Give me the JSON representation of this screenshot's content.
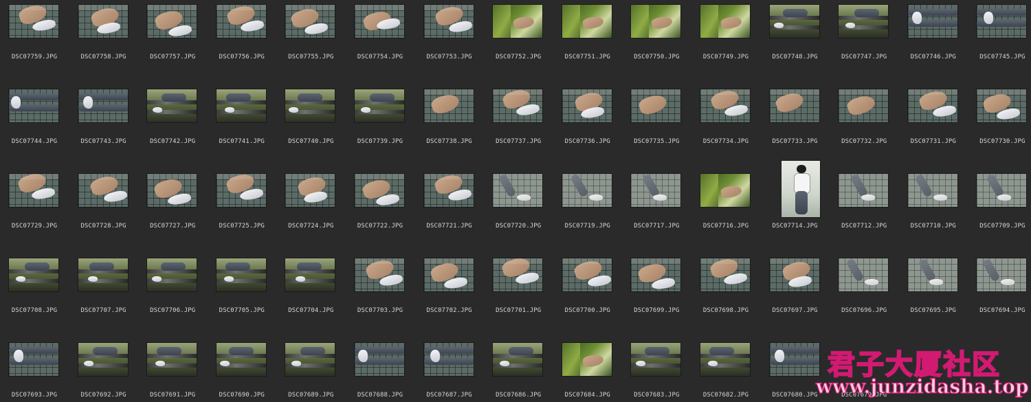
{
  "files": [
    {
      "name": "DSC07759.JPG",
      "v": "fs"
    },
    {
      "name": "DSC07758.JPG",
      "v": "fs"
    },
    {
      "name": "DSC07757.JPG",
      "v": "fs"
    },
    {
      "name": "DSC07756.JPG",
      "v": "fs"
    },
    {
      "name": "DSC07755.JPG",
      "v": "fs"
    },
    {
      "name": "DSC07754.JPG",
      "v": "fs"
    },
    {
      "name": "DSC07753.JPG",
      "v": "fs"
    },
    {
      "name": "DSC07752.JPG",
      "v": "gr"
    },
    {
      "name": "DSC07751.JPG",
      "v": "gr"
    },
    {
      "name": "DSC07750.JPG",
      "v": "gr"
    },
    {
      "name": "DSC07749.JPG",
      "v": "gr"
    },
    {
      "name": "DSC07748.JPG",
      "v": "bn"
    },
    {
      "name": "DSC07747.JPG",
      "v": "bn"
    },
    {
      "name": "DSC07746.JPG",
      "v": "lg"
    },
    {
      "name": "DSC07745.JPG",
      "v": "lg"
    },
    {
      "name": "DSC07744.JPG",
      "v": "lg"
    },
    {
      "name": "DSC07743.JPG",
      "v": "lg"
    },
    {
      "name": "DSC07742.JPG",
      "v": "bn"
    },
    {
      "name": "DSC07741.JPG",
      "v": "bn"
    },
    {
      "name": "DSC07740.JPG",
      "v": "bn"
    },
    {
      "name": "DSC07739.JPG",
      "v": "bn"
    },
    {
      "name": "DSC07738.JPG",
      "v": "ft"
    },
    {
      "name": "DSC07737.JPG",
      "v": "fs"
    },
    {
      "name": "DSC07736.JPG",
      "v": "fs"
    },
    {
      "name": "DSC07735.JPG",
      "v": "ft"
    },
    {
      "name": "DSC07734.JPG",
      "v": "fs"
    },
    {
      "name": "DSC07733.JPG",
      "v": "ft"
    },
    {
      "name": "DSC07732.JPG",
      "v": "ft"
    },
    {
      "name": "DSC07731.JPG",
      "v": "fs"
    },
    {
      "name": "DSC07730.JPG",
      "v": "fs"
    },
    {
      "name": "DSC07729.JPG",
      "v": "fs"
    },
    {
      "name": "DSC07728.JPG",
      "v": "fs"
    },
    {
      "name": "DSC07727.JPG",
      "v": "fs"
    },
    {
      "name": "DSC07725.JPG",
      "v": "fs"
    },
    {
      "name": "DSC07724.JPG",
      "v": "fs"
    },
    {
      "name": "DSC07722.JPG",
      "v": "fs"
    },
    {
      "name": "DSC07721.JPG",
      "v": "fs"
    },
    {
      "name": "DSC07720.JPG",
      "v": "pv"
    },
    {
      "name": "DSC07719.JPG",
      "v": "pv"
    },
    {
      "name": "DSC07717.JPG",
      "v": "pv"
    },
    {
      "name": "DSC07716.JPG",
      "v": "gr"
    },
    {
      "name": "DSC07714.JPG",
      "v": "pt"
    },
    {
      "name": "DSC07712.JPG",
      "v": "pv"
    },
    {
      "name": "DSC07710.JPG",
      "v": "pv"
    },
    {
      "name": "DSC07709.JPG",
      "v": "pv"
    },
    {
      "name": "DSC07708.JPG",
      "v": "bn"
    },
    {
      "name": "DSC07707.JPG",
      "v": "bn"
    },
    {
      "name": "DSC07706.JPG",
      "v": "bn"
    },
    {
      "name": "DSC07705.JPG",
      "v": "bn"
    },
    {
      "name": "DSC07704.JPG",
      "v": "bn"
    },
    {
      "name": "DSC07703.JPG",
      "v": "fs"
    },
    {
      "name": "DSC07702.JPG",
      "v": "fs"
    },
    {
      "name": "DSC07701.JPG",
      "v": "fs"
    },
    {
      "name": "DSC07700.JPG",
      "v": "fs"
    },
    {
      "name": "DSC07699.JPG",
      "v": "fs"
    },
    {
      "name": "DSC07698.JPG",
      "v": "fs"
    },
    {
      "name": "DSC07697.JPG",
      "v": "fs"
    },
    {
      "name": "DSC07696.JPG",
      "v": "pv"
    },
    {
      "name": "DSC07695.JPG",
      "v": "pv"
    },
    {
      "name": "DSC07694.JPG",
      "v": "pv"
    },
    {
      "name": "DSC07693.JPG",
      "v": "lg"
    },
    {
      "name": "DSC07692.JPG",
      "v": "bn"
    },
    {
      "name": "DSC07691.JPG",
      "v": "bn"
    },
    {
      "name": "DSC07690.JPG",
      "v": "bn"
    },
    {
      "name": "DSC07689.JPG",
      "v": "bn"
    },
    {
      "name": "DSC07688.JPG",
      "v": "lg"
    },
    {
      "name": "DSC07687.JPG",
      "v": "lg"
    },
    {
      "name": "DSC07686.JPG",
      "v": "bn"
    },
    {
      "name": "DSC07684.JPG",
      "v": "gr"
    },
    {
      "name": "DSC07683.JPG",
      "v": "bn"
    },
    {
      "name": "DSC07682.JPG",
      "v": "bn"
    },
    {
      "name": "DSC07680.JPG",
      "v": "lg"
    },
    {
      "name": "DSC07679.JPG",
      "v": "none"
    },
    {
      "name": "",
      "v": "none"
    },
    {
      "name": "",
      "v": "none"
    }
  ],
  "watermark": {
    "title": "君子大厦社区",
    "url": "www.junzidasha.top"
  }
}
